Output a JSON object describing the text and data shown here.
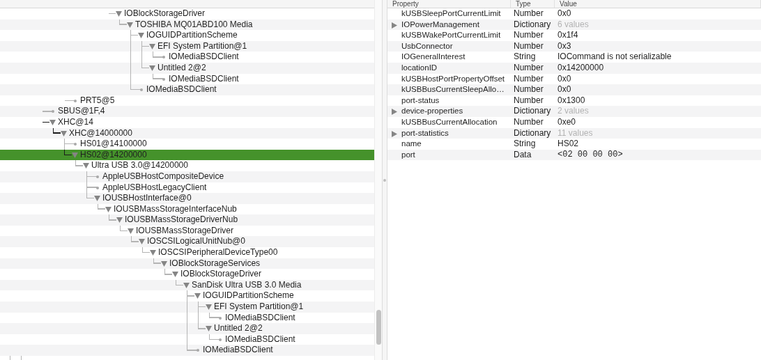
{
  "tree": [
    {
      "label": "IOBlockStorageDriver",
      "kind": "branch",
      "expanded": true,
      "selected": false,
      "children": [
        {
          "label": "TOSHIBA MQ01ABD100 Media",
          "kind": "branch",
          "expanded": true,
          "selected": false,
          "children": [
            {
              "label": "IOGUIDPartitionScheme",
              "kind": "branch",
              "expanded": true,
              "selected": false,
              "children": [
                {
                  "label": "EFI System Partition@1",
                  "kind": "branch",
                  "expanded": true,
                  "selected": false,
                  "children": [
                    {
                      "label": "IOMediaBSDClient",
                      "kind": "leaf",
                      "selected": false
                    }
                  ]
                },
                {
                  "label": "Untitled 2@2",
                  "kind": "branch",
                  "expanded": true,
                  "selected": false,
                  "children": [
                    {
                      "label": "IOMediaBSDClient",
                      "kind": "leaf",
                      "selected": false
                    }
                  ]
                }
              ]
            },
            {
              "label": "IOMediaBSDClient",
              "kind": "leaf",
              "selected": false
            }
          ]
        }
      ]
    },
    {
      "label": "PRT5@5",
      "kind": "leaf",
      "selected": false
    },
    {
      "label": "SBUS@1F,4",
      "kind": "leaf",
      "selected": false
    },
    {
      "label": "XHC@14",
      "kind": "branch",
      "expanded": true,
      "selected": false,
      "children": [
        {
          "label": "XHC@14000000",
          "kind": "branch",
          "expanded": true,
          "selected": false,
          "children": [
            {
              "label": "HS01@14100000",
              "kind": "leaf",
              "selected": false
            },
            {
              "label": "HS02@14200000",
              "kind": "branch",
              "expanded": true,
              "selected": true,
              "children": [
                {
                  "label": "Ultra USB 3.0@14200000",
                  "kind": "branch",
                  "expanded": true,
                  "selected": false,
                  "children": [
                    {
                      "label": "AppleUSBHostCompositeDevice",
                      "kind": "leaf",
                      "selected": false
                    },
                    {
                      "label": "AppleUSBHostLegacyClient",
                      "kind": "leaf",
                      "selected": false
                    },
                    {
                      "label": "IOUSBHostInterface@0",
                      "kind": "branch",
                      "expanded": true,
                      "selected": false,
                      "children": [
                        {
                          "label": "IOUSBMassStorageInterfaceNub",
                          "kind": "branch",
                          "expanded": true,
                          "selected": false,
                          "children": [
                            {
                              "label": "IOUSBMassStorageDriverNub",
                              "kind": "branch",
                              "expanded": true,
                              "selected": false,
                              "children": [
                                {
                                  "label": "IOUSBMassStorageDriver",
                                  "kind": "branch",
                                  "expanded": true,
                                  "selected": false,
                                  "children": [
                                    {
                                      "label": "IOSCSILogicalUnitNub@0",
                                      "kind": "branch",
                                      "expanded": true,
                                      "selected": false,
                                      "children": [
                                        {
                                          "label": "IOSCSIPeripheralDeviceType00",
                                          "kind": "branch",
                                          "expanded": true,
                                          "selected": false,
                                          "children": [
                                            {
                                              "label": "IOBlockStorageServices",
                                              "kind": "branch",
                                              "expanded": true,
                                              "selected": false,
                                              "children": [
                                                {
                                                  "label": "IOBlockStorageDriver",
                                                  "kind": "branch",
                                                  "expanded": true,
                                                  "selected": false,
                                                  "children": [
                                                    {
                                                      "label": "SanDisk Ultra USB 3.0 Media",
                                                      "kind": "branch",
                                                      "expanded": true,
                                                      "selected": false,
                                                      "children": [
                                                        {
                                                          "label": "IOGUIDPartitionScheme",
                                                          "kind": "branch",
                                                          "expanded": true,
                                                          "selected": false,
                                                          "children": [
                                                            {
                                                              "label": "EFI System Partition@1",
                                                              "kind": "branch",
                                                              "expanded": true,
                                                              "selected": false,
                                                              "children": [
                                                                {
                                                                  "label": "IOMediaBSDClient",
                                                                  "kind": "leaf",
                                                                  "selected": false
                                                                }
                                                              ]
                                                            },
                                                            {
                                                              "label": "Untitled 2@2",
                                                              "kind": "branch",
                                                              "expanded": true,
                                                              "selected": false,
                                                              "children": [
                                                                {
                                                                  "label": "IOMediaBSDClient",
                                                                  "kind": "leaf",
                                                                  "selected": false
                                                                }
                                                              ]
                                                            }
                                                          ]
                                                        },
                                                        {
                                                          "label": "IOMediaBSDClient",
                                                          "kind": "leaf",
                                                          "selected": false
                                                        }
                                                      ]
                                                    }
                                                  ]
                                                }
                                              ]
                                            }
                                          ]
                                        }
                                      ]
                                    }
                                  ]
                                }
                              ]
                            }
                          ]
                        }
                      ]
                    }
                  ]
                }
              ]
            }
          ]
        }
      ]
    }
  ],
  "properties": {
    "columns": [
      "Property",
      "Type",
      "Value"
    ],
    "rows": [
      {
        "property": "kUSBSleepPortCurrentLimit",
        "type": "Number",
        "value": "0x0",
        "kind": "scalar"
      },
      {
        "property": "IOPowerManagement",
        "type": "Dictionary",
        "value": "6 values",
        "kind": "collection",
        "expanded": false
      },
      {
        "property": "kUSBWakePortCurrentLimit",
        "type": "Number",
        "value": "0x1f4",
        "kind": "scalar"
      },
      {
        "property": "UsbConnector",
        "type": "Number",
        "value": "0x3",
        "kind": "scalar"
      },
      {
        "property": "IOGeneralInterest",
        "type": "String",
        "value": "IOCommand is not serializable",
        "kind": "scalar"
      },
      {
        "property": "locationID",
        "type": "Number",
        "value": "0x14200000",
        "kind": "scalar"
      },
      {
        "property": "kUSBHostPortPropertyOffset",
        "type": "Number",
        "value": "0x0",
        "kind": "scalar"
      },
      {
        "property": "kUSBBusCurrentSleepAllo…",
        "type": "Number",
        "value": "0x0",
        "kind": "scalar"
      },
      {
        "property": "port-status",
        "type": "Number",
        "value": "0x1300",
        "kind": "scalar"
      },
      {
        "property": "device-properties",
        "type": "Dictionary",
        "value": "2 values",
        "kind": "collection",
        "expanded": false
      },
      {
        "property": "kUSBBusCurrentAllocation",
        "type": "Number",
        "value": "0xe0",
        "kind": "scalar"
      },
      {
        "property": "port-statistics",
        "type": "Dictionary",
        "value": "11 values",
        "kind": "collection",
        "expanded": false
      },
      {
        "property": "name",
        "type": "String",
        "value": "HS02",
        "kind": "scalar"
      },
      {
        "property": "port",
        "type": "Data",
        "value": "<02 00 00 00>",
        "kind": "data"
      }
    ]
  }
}
